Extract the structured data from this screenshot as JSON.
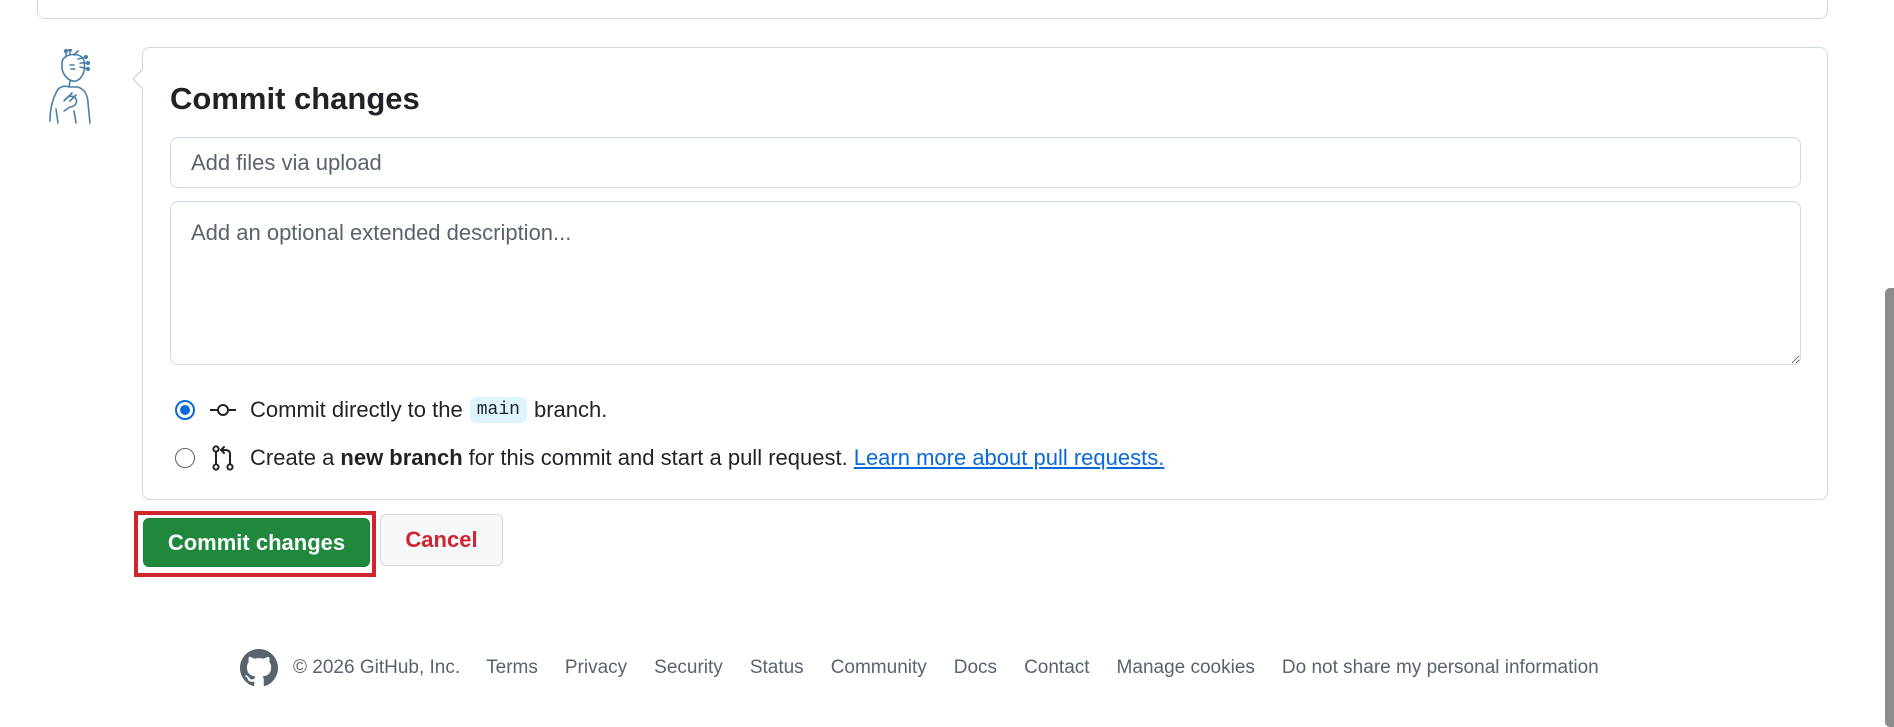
{
  "commit_form": {
    "title": "Commit changes",
    "message_placeholder": "Add files via upload",
    "description_placeholder": "Add an optional extended description...",
    "option_direct": {
      "text_before": "Commit directly to the",
      "branch": "main",
      "text_after": "branch.",
      "checked": true
    },
    "option_new_branch": {
      "text_before": "Create a",
      "bold": "new branch",
      "text_after": "for this commit and start a pull request.",
      "link": "Learn more about pull requests.",
      "checked": false
    }
  },
  "actions": {
    "commit_label": "Commit changes",
    "cancel_label": "Cancel"
  },
  "footer": {
    "copyright": "© 2026 GitHub, Inc.",
    "links": [
      "Terms",
      "Privacy",
      "Security",
      "Status",
      "Community",
      "Docs",
      "Contact",
      "Manage cookies",
      "Do not share my personal information"
    ]
  },
  "colors": {
    "primary_button": "#1f883d",
    "danger_text": "#d1242f",
    "link": "#0969da",
    "highlight": "#d1242f"
  },
  "icons": {
    "avatar": "copilot-avatar-icon",
    "direct_commit": "git-commit-icon",
    "new_branch": "git-pull-request-icon",
    "footer_logo": "github-mark-icon"
  }
}
